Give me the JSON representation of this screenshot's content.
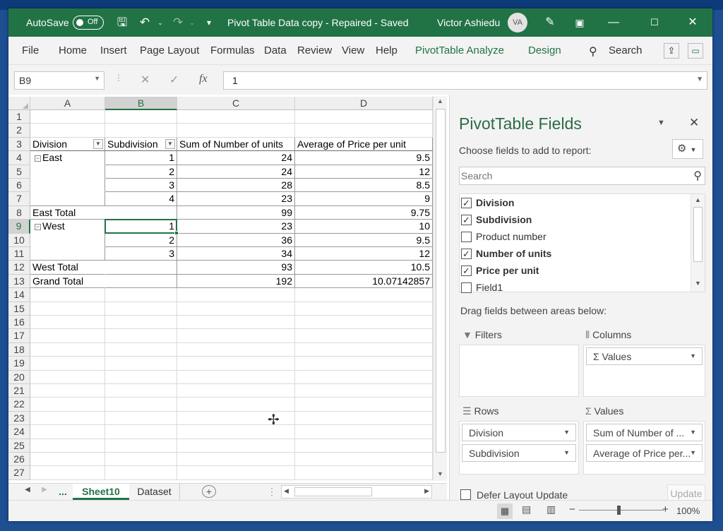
{
  "titlebar": {
    "autosave": "AutoSave",
    "toggle": "Off",
    "doc_title": "Pivot Table Data copy  -  Repaired  -  Saved",
    "user": "Victor Ashiedu",
    "avatar": "VA"
  },
  "menu": [
    "File",
    "Home",
    "Insert",
    "Page Layout",
    "Formulas",
    "Data",
    "Review",
    "View",
    "Help",
    "PivotTable Analyze",
    "Design"
  ],
  "search": {
    "label": "Search"
  },
  "formula": {
    "namebox": "B9",
    "fx": "fx",
    "value": "1"
  },
  "columns": [
    "A",
    "B",
    "C",
    "D"
  ],
  "rows": [
    "1",
    "2",
    "3",
    "4",
    "5",
    "6",
    "7",
    "8",
    "9",
    "10",
    "11",
    "12",
    "13",
    "14",
    "15",
    "16",
    "17",
    "18",
    "19",
    "20",
    "21",
    "22",
    "23",
    "24",
    "25",
    "26",
    "27"
  ],
  "pivot": {
    "headers": {
      "a": "Division",
      "b": "Subdivision",
      "c": "Sum of Number of units",
      "d": "Average of Price per unit"
    },
    "body": [
      {
        "a": "East",
        "b": "1",
        "c": "24",
        "d": "9.5"
      },
      {
        "a": "",
        "b": "2",
        "c": "24",
        "d": "12"
      },
      {
        "a": "",
        "b": "3",
        "c": "28",
        "d": "8.5"
      },
      {
        "a": "",
        "b": "4",
        "c": "23",
        "d": "9"
      },
      {
        "a": "East Total",
        "b": "",
        "c": "99",
        "d": "9.75"
      },
      {
        "a": "West",
        "b": "1",
        "c": "23",
        "d": "10"
      },
      {
        "a": "",
        "b": "2",
        "c": "36",
        "d": "9.5"
      },
      {
        "a": "",
        "b": "3",
        "c": "34",
        "d": "12"
      },
      {
        "a": "West Total",
        "b": "",
        "c": "93",
        "d": "10.5"
      },
      {
        "a": "Grand Total",
        "b": "",
        "c": "192",
        "d": "10.07142857"
      }
    ]
  },
  "tabs": {
    "ellipsis": "...",
    "sheet10": "Sheet10",
    "dataset": "Dataset"
  },
  "pane": {
    "title": "PivotTable Fields",
    "choose": "Choose fields to add to report:",
    "search_placeholder": "Search",
    "fields": [
      {
        "label": "Division",
        "checked": true
      },
      {
        "label": "Subdivision",
        "checked": true
      },
      {
        "label": "Product number",
        "checked": false
      },
      {
        "label": "Number of units",
        "checked": true
      },
      {
        "label": "Price per unit",
        "checked": true
      },
      {
        "label": "Field1",
        "checked": false
      }
    ],
    "drag_label": "Drag fields between areas below:",
    "filters": "Filters",
    "columns": "Columns",
    "columns_items": [
      "Values"
    ],
    "rows": "Rows",
    "rows_items": [
      "Division",
      "Subdivision"
    ],
    "values": "Values",
    "values_items": [
      "Sum of Number of ...",
      "Average of Price per..."
    ],
    "defer": "Defer Layout Update",
    "update": "Update"
  },
  "status": {
    "zoom": "100%"
  }
}
